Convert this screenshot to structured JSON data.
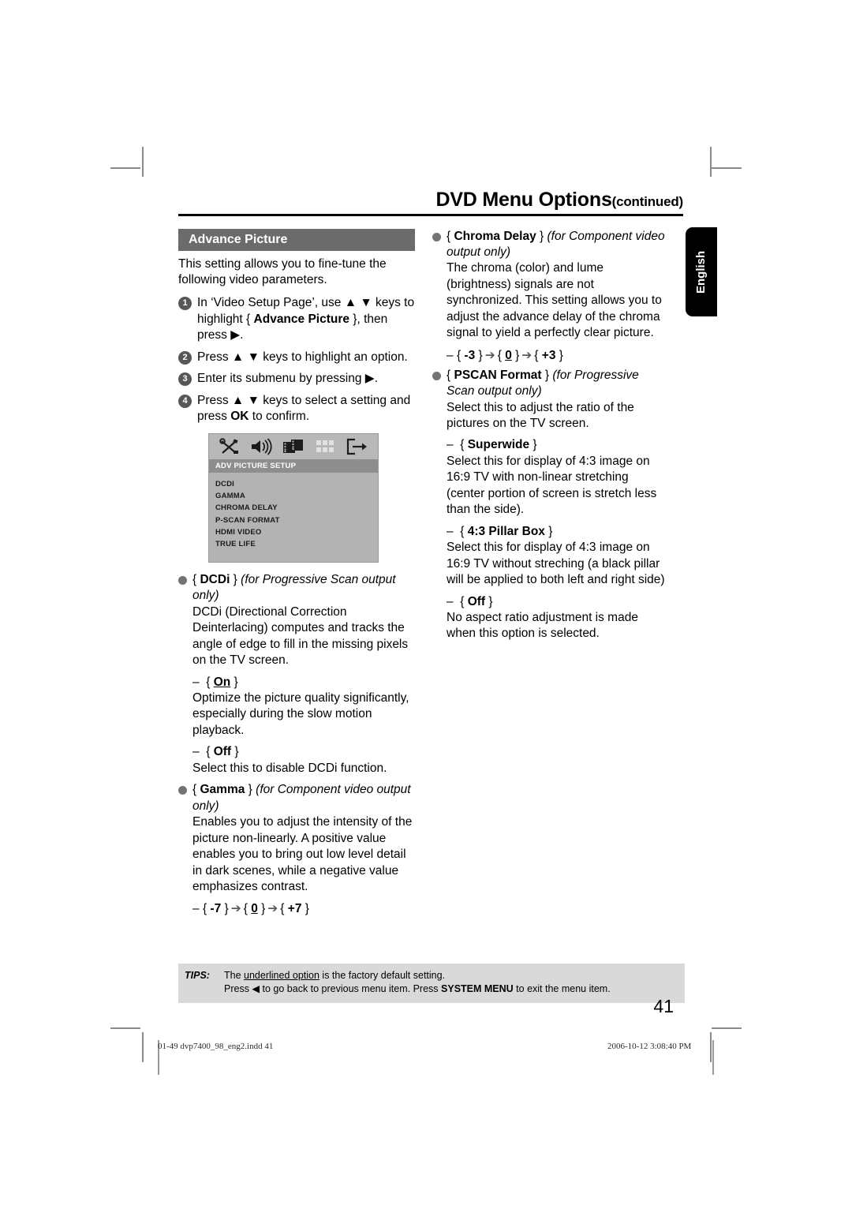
{
  "running_head": {
    "title": "DVD Menu Options",
    "continued": "(continued)"
  },
  "language_tab": {
    "label": "English"
  },
  "left_column": {
    "section_title": "Advance Picture",
    "intro": "This setting allows you to fine-tune the following video parameters.",
    "steps": [
      {
        "num": "1",
        "text_before": "In ‘Video Setup Page’, use ▲ ▼ keys to highlight { ",
        "bold": "Advance Picture",
        "text_after": " }, then press ▶."
      },
      {
        "num": "2",
        "text_before": "Press ▲ ▼ keys to highlight an option.",
        "bold": "",
        "text_after": ""
      },
      {
        "num": "3",
        "text_before": "Enter its submenu by pressing ▶.",
        "bold": "",
        "text_after": ""
      },
      {
        "num": "4",
        "text_before": "Press ▲ ▼ keys to select a setting and press ",
        "bold": "OK",
        "text_after": " to confirm."
      }
    ],
    "osd": {
      "title": "ADV PICTURE SETUP",
      "icons": [
        "tools-icon",
        "speaker-icon",
        "film-icon",
        "grid-icon",
        "exit-icon"
      ],
      "items": [
        "DCDI",
        "GAMMA",
        "CHROMA DELAY",
        "P-SCAN FORMAT",
        "HDMI VIDEO",
        "TRUE LIFE"
      ]
    },
    "options": [
      {
        "name": "DCDi",
        "qualifier": "(for Progressive Scan output only)",
        "description": "DCDi (Directional Correction Deinterlacing) computes and tracks the angle of edge to fill in the missing pixels on the TV screen.",
        "settings": [
          {
            "label": "On",
            "underlined": true,
            "text": "Optimize the picture quality significantly, especially during the slow motion playback."
          },
          {
            "label": "Off",
            "underlined": false,
            "text": "Select this to disable DCDi function."
          }
        ],
        "range": null
      },
      {
        "name": "Gamma",
        "qualifier": "(for Component video output only)",
        "description": "Enables you to adjust the intensity of the picture non-linearly. A positive value enables you to bring out low level detail in dark scenes, while a negative value emphasizes contrast.",
        "settings": [],
        "range": {
          "min": "-7",
          "mid": "0",
          "max": "+7",
          "mid_underlined": true
        }
      }
    ]
  },
  "right_column": {
    "options": [
      {
        "name": "Chroma Delay",
        "qualifier": "(for Component video output only)",
        "description": "The chroma (color) and lume (brightness) signals are not synchronized. This setting allows you to adjust the advance delay of the chroma signal to yield a perfectly clear picture.",
        "settings": [],
        "range": {
          "min": "-3",
          "mid": "0",
          "max": "+3",
          "mid_underlined": true
        }
      },
      {
        "name": "PSCAN Format",
        "qualifier": "(for Progressive Scan output only)",
        "description": "Select this to adjust the ratio of the pictures on the TV screen.",
        "settings": [
          {
            "label": "Superwide",
            "underlined": false,
            "text": "Select this for display of 4:3 image on 16:9 TV with non-linear stretching (center portion of screen is stretch less than the side)."
          },
          {
            "label": "4:3 Pillar Box",
            "underlined": false,
            "text": "Select this for display of 4:3 image on 16:9 TV without streching (a black pillar will be applied to both left and right side)"
          },
          {
            "label": "Off",
            "underlined": false,
            "text": "No aspect ratio adjustment is made when this option is selected."
          }
        ],
        "range": null
      }
    ]
  },
  "tips": {
    "label": "TIPS:",
    "line1_before": "The ",
    "line1_underlined": "underlined option",
    "line1_after": " is the factory default setting.",
    "line2_before": "Press ◀ to go back to previous menu item. Press ",
    "line2_bold": "SYSTEM MENU",
    "line2_after": " to exit the menu item."
  },
  "page_number": "41",
  "footer": {
    "file": "01-49 dvp7400_98_eng2.indd   41",
    "timestamp": "2006-10-12   3:08:40 PM"
  },
  "colors": {
    "section_bar": "#6b6b6b",
    "bullet": "#737373",
    "step_num": "#575757",
    "tips_bg": "#d9d9d9",
    "osd_bg": "#b3b3b3",
    "osd_title_bg": "#8e8e8e"
  }
}
